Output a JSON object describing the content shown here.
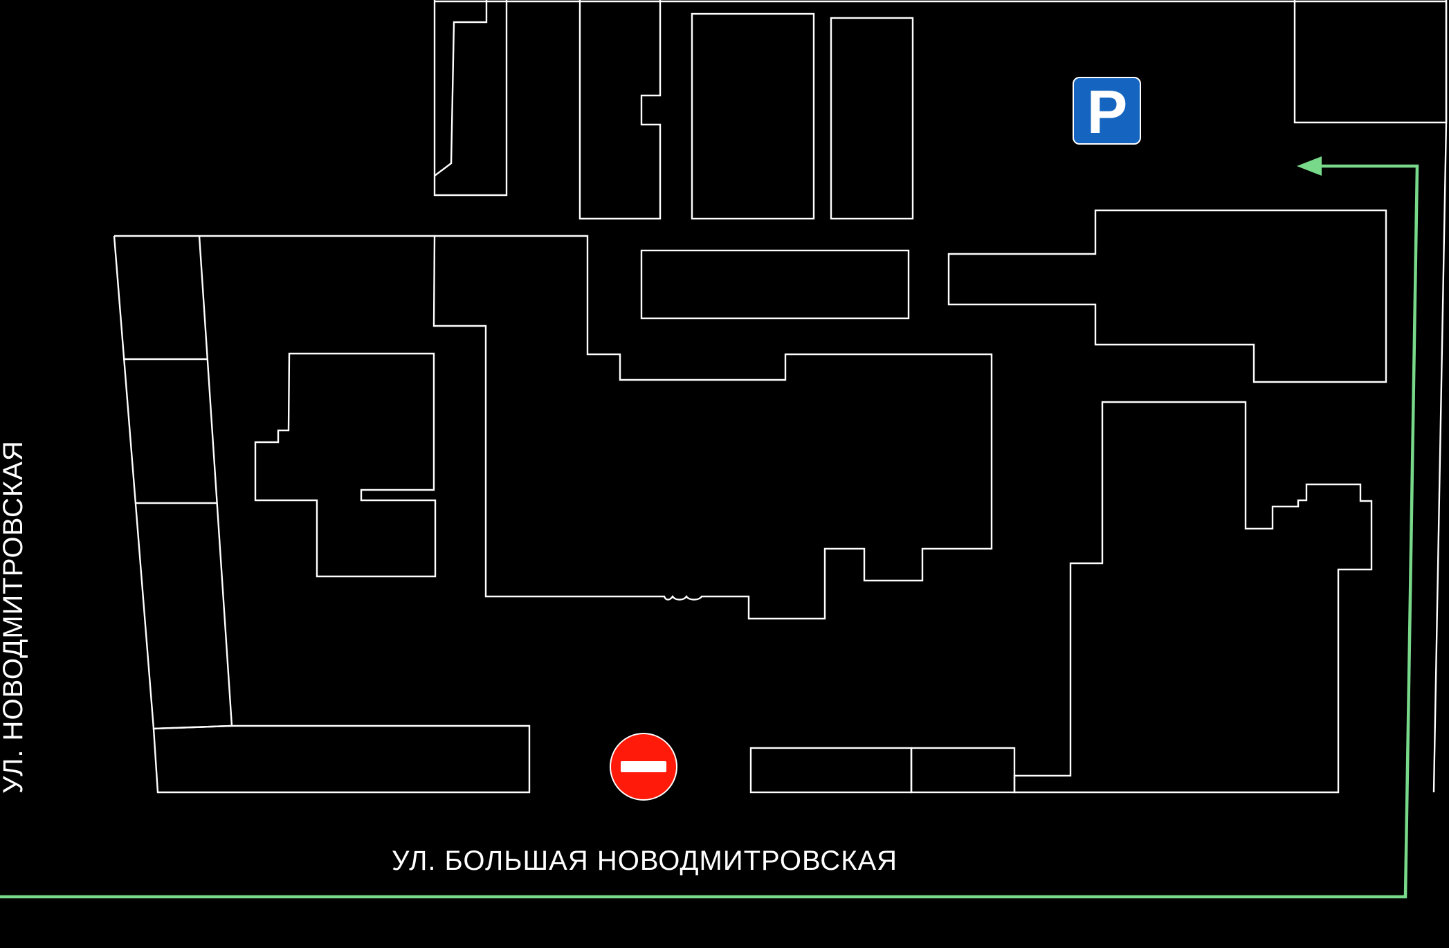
{
  "streets": {
    "bottom": "УЛ. БОЛЬШАЯ НОВОДМИТРОВСКАЯ",
    "left": "УЛ. НОВОДМИТРОВСКАЯ"
  },
  "parking_sign": {
    "letter": "P",
    "color": "#1565c0"
  },
  "no_entry_sign": {
    "color": "#ff1a0a"
  },
  "route": {
    "color": "#79d98a"
  },
  "buildings": [
    "building-1",
    "building-2",
    "building-3",
    "building-4",
    "building-5",
    "building-6",
    "building-7",
    "building-8",
    "building-9",
    "building-10",
    "building-11",
    "building-12",
    "building-13",
    "building-14",
    "building-15"
  ]
}
